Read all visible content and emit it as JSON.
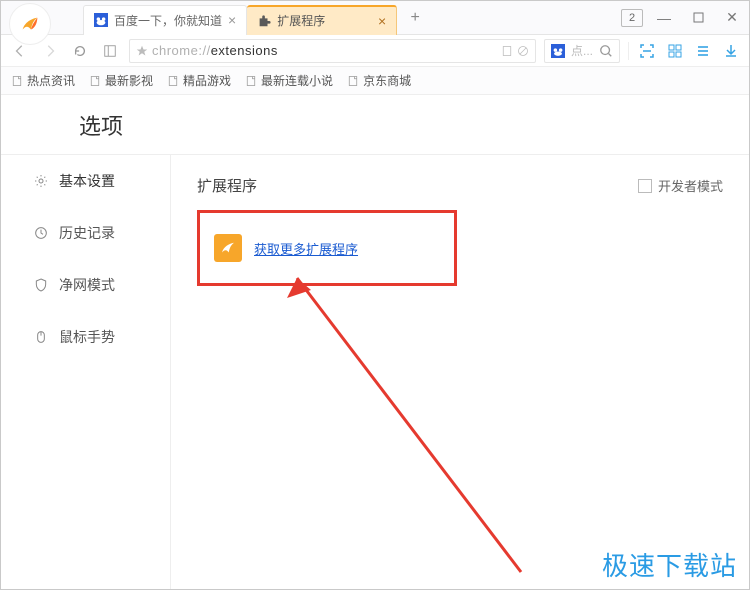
{
  "titlebar": {
    "tabs": [
      {
        "label": "百度一下，你就知道",
        "icon": "baidu"
      },
      {
        "label": "扩展程序",
        "icon": "puzzle"
      }
    ],
    "tabCount": "2"
  },
  "addressbar": {
    "url_prefix": "chrome://",
    "url_path": "extensions",
    "placeholder": "点..."
  },
  "bookmarks": [
    "热点资讯",
    "最新影视",
    "精品游戏",
    "最新连载小说",
    "京东商城"
  ],
  "page": {
    "title": "选项"
  },
  "sidebar": {
    "items": [
      "基本设置",
      "历史记录",
      "净网模式",
      "鼠标手势"
    ]
  },
  "main": {
    "title": "扩展程序",
    "dev_mode_label": "开发者模式",
    "get_more_label": "获取更多扩展程序"
  },
  "watermark": "极速下载站"
}
